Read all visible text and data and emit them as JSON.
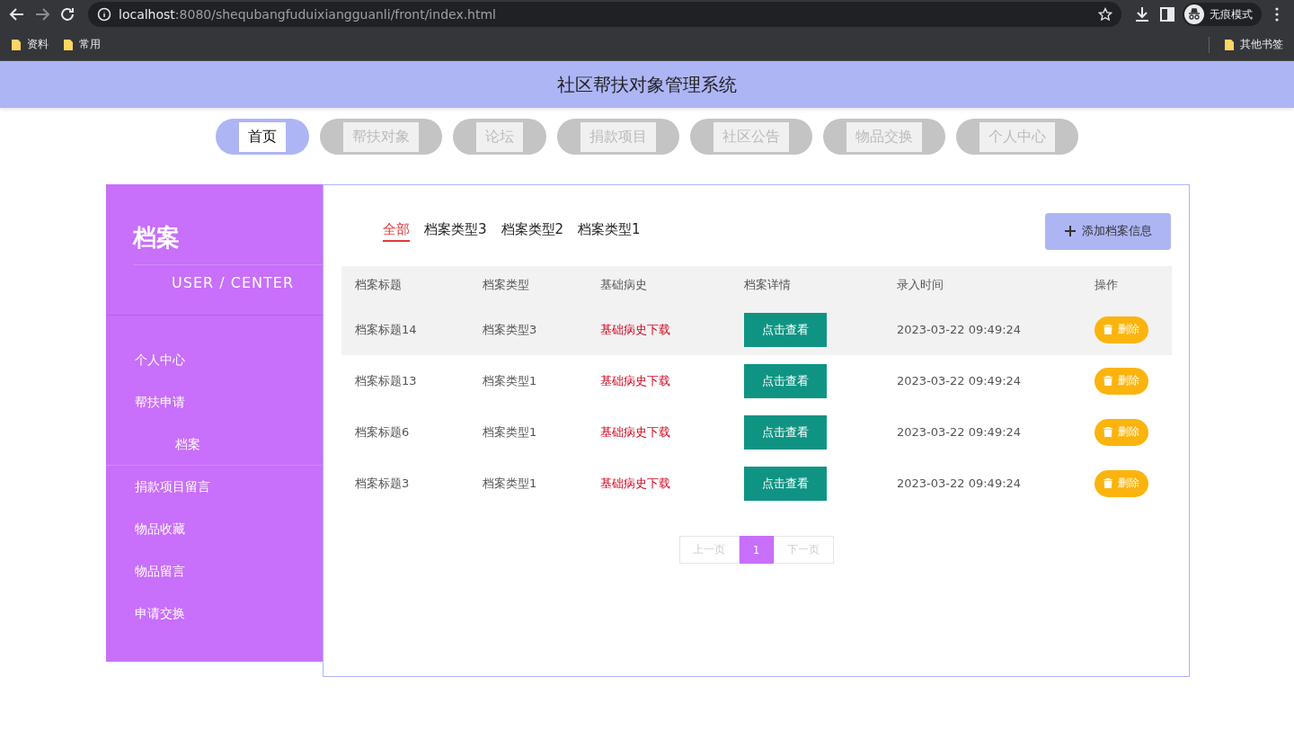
{
  "browser": {
    "url_host": "localhost",
    "url_rest": ":8080/shequbangfuduixiangguanli/front/index.html",
    "profile": "无痕模式",
    "bookmarks": [
      "资料",
      "常用"
    ],
    "other_bookmarks": "其他书签"
  },
  "header": {
    "title": "社区帮扶对象管理系统"
  },
  "nav": [
    {
      "label": "首页",
      "selected": true
    },
    {
      "label": "帮扶对象",
      "selected": false
    },
    {
      "label": "论坛",
      "selected": false
    },
    {
      "label": "捐款项目",
      "selected": false
    },
    {
      "label": "社区公告",
      "selected": false
    },
    {
      "label": "物品交换",
      "selected": false
    },
    {
      "label": "个人中心",
      "selected": false
    }
  ],
  "sidebar": {
    "title": "档案",
    "subtitle": "USER / CENTER",
    "items": [
      {
        "label": "个人中心",
        "selected": false
      },
      {
        "label": "帮扶申请",
        "selected": false
      },
      {
        "label": "档案",
        "selected": true
      },
      {
        "label": "捐款项目留言",
        "selected": false
      },
      {
        "label": "物品收藏",
        "selected": false
      },
      {
        "label": "物品留言",
        "selected": false
      },
      {
        "label": "申请交换",
        "selected": false
      }
    ]
  },
  "filters": [
    {
      "label": "全部",
      "selected": true
    },
    {
      "label": "档案类型3",
      "selected": false
    },
    {
      "label": "档案类型2",
      "selected": false
    },
    {
      "label": "档案类型1",
      "selected": false
    }
  ],
  "add_button": "添加档案信息",
  "table": {
    "columns": [
      "档案标题",
      "档案类型",
      "基础病史",
      "档案详情",
      "录入时间",
      "操作"
    ],
    "rows": [
      {
        "title": "档案标题14",
        "type": "档案类型3",
        "history": "基础病史下载",
        "detail": "点击查看",
        "time": "2023-03-22 09:49:24",
        "action": "删除",
        "highlighted": true
      },
      {
        "title": "档案标题13",
        "type": "档案类型1",
        "history": "基础病史下载",
        "detail": "点击查看",
        "time": "2023-03-22 09:49:24",
        "action": "删除",
        "highlighted": false
      },
      {
        "title": "档案标题6",
        "type": "档案类型1",
        "history": "基础病史下载",
        "detail": "点击查看",
        "time": "2023-03-22 09:49:24",
        "action": "删除",
        "highlighted": false
      },
      {
        "title": "档案标题3",
        "type": "档案类型1",
        "history": "基础病史下载",
        "detail": "点击查看",
        "time": "2023-03-22 09:49:24",
        "action": "删除",
        "highlighted": false
      }
    ]
  },
  "pagination": {
    "prev": "上一页",
    "pages": [
      {
        "label": "1",
        "selected": true
      }
    ],
    "next": "下一页"
  }
}
